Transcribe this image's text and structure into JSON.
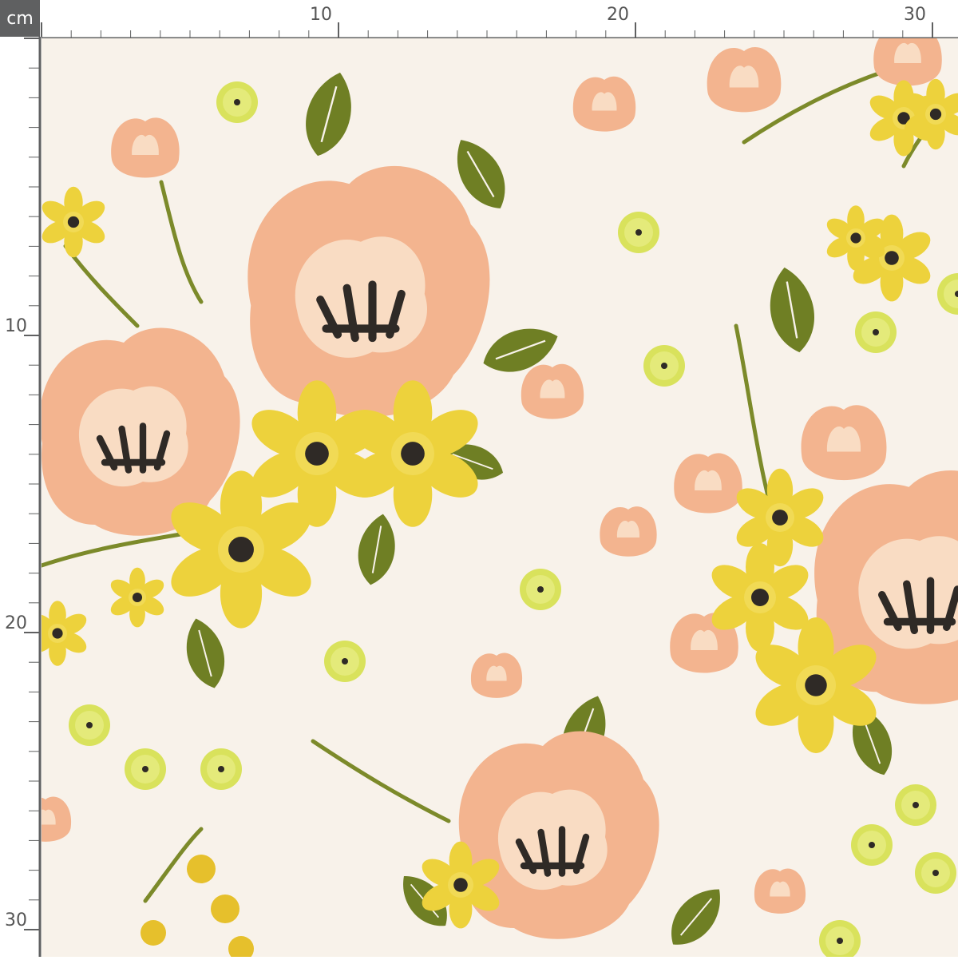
{
  "ruler": {
    "unit": "cm",
    "top_labels": [
      "10",
      "20",
      "30"
    ],
    "left_labels": [
      "10",
      "20",
      "30"
    ]
  },
  "fabric": {
    "icon": "floral-pattern-swatch",
    "colors": {
      "background": "#f8f2ea",
      "peach": "#f3b48f",
      "peach_light": "#f9dcc3",
      "yellow": "#edd23c",
      "lime": "#d9e25c",
      "leaf": "#6f7f24",
      "leaf_dark": "#5a6a1b",
      "center": "#2f2a26",
      "ruler_line": "#5f6061"
    }
  }
}
